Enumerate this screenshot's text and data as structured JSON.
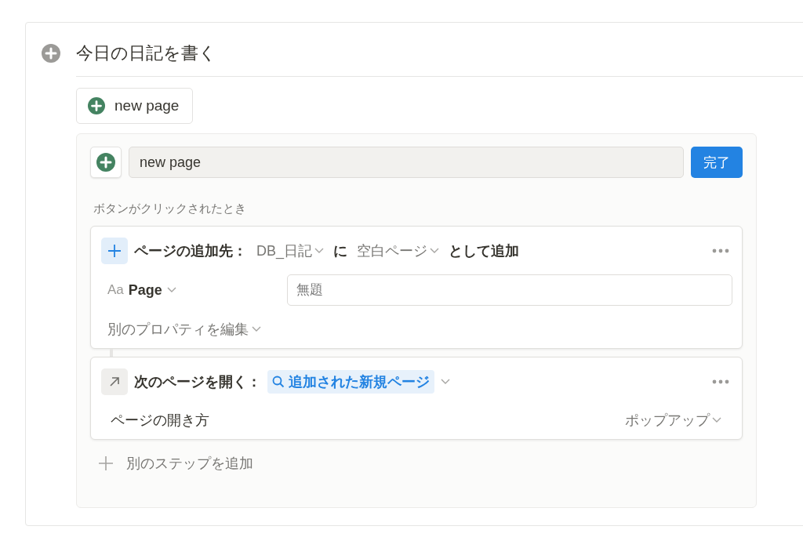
{
  "block": {
    "title": "今日の日記を書く"
  },
  "button": {
    "label": "new page"
  },
  "editor": {
    "name_value": "new page",
    "done": "完了",
    "trigger_label": "ボタンがクリックされたとき",
    "steps": [
      {
        "kind": "add_page",
        "label": "ページの追加先：",
        "database": "DB_日記",
        "connector": "に",
        "template": "空白ページ",
        "suffix": "として追加",
        "property": {
          "icon_text": "Aa",
          "name": "Page",
          "placeholder": "無題"
        },
        "more": "別のプロパティを編集"
      },
      {
        "kind": "open_page",
        "label": "次のページを開く：",
        "target": "追加された新規ページ",
        "option_label": "ページの開き方",
        "option_value": "ポップアップ"
      }
    ],
    "add_step": "別のステップを追加"
  }
}
